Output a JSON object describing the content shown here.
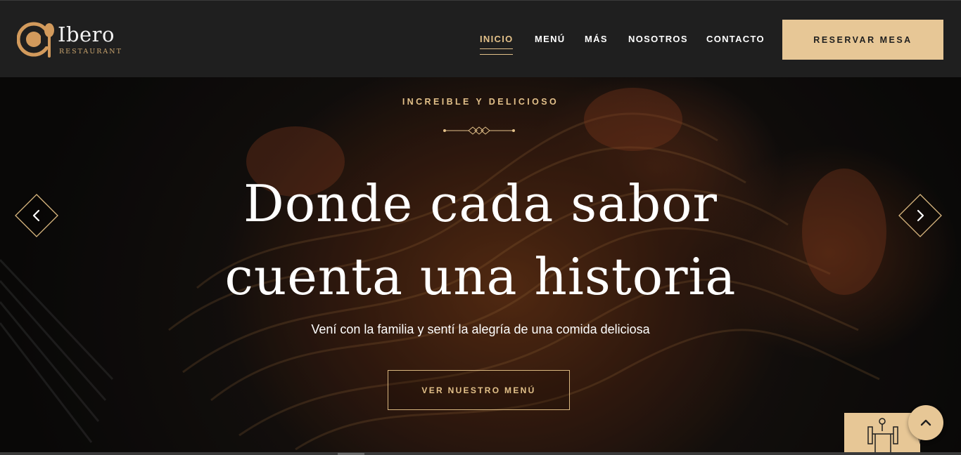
{
  "brand": {
    "name": "Ibero",
    "subtitle": "RESTAURANT",
    "logo_icon": "cup-spoon-logo-icon",
    "accent_color": "#e7c796"
  },
  "nav": {
    "items": [
      {
        "label": "INICIO",
        "active": true
      },
      {
        "label": "MENÚ",
        "active": false
      },
      {
        "label": "MÁS",
        "active": false
      },
      {
        "label": "NOSOTROS",
        "active": false
      },
      {
        "label": "CONTACTO",
        "active": false
      }
    ],
    "cta_label": "RESERVAR MESA"
  },
  "hero": {
    "eyebrow": "INCREIBLE Y DELICIOSO",
    "title_line1": "Donde cada sabor",
    "title_line2": "cuenta una historia",
    "subtitle": "Vení con la familia y sentí la alegría de una comida deliciosa",
    "button_label": "VER NUESTRO MENÚ",
    "prev_icon": "chevron-left-icon",
    "next_icon": "chevron-right-icon"
  },
  "floating": {
    "widget_icon": "dining-table-icon",
    "scroll_top_icon": "chevron-up-icon"
  }
}
